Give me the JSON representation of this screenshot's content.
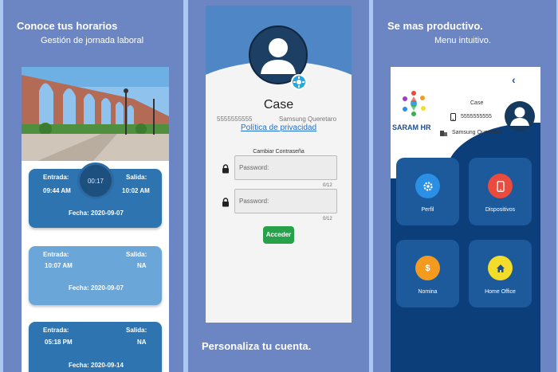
{
  "panel1": {
    "title": "Conoce tus horarios",
    "subtitle": "Gestión de jornada laboral",
    "timer": "00:17",
    "cards": [
      {
        "entrada_label": "Entrada:",
        "entrada": "09:44 AM",
        "salida_label": "Salida:",
        "salida": "10:02 AM",
        "fecha": "Fecha: 2020-09-07"
      },
      {
        "entrada_label": "Entrada:",
        "entrada": "10:07 AM",
        "salida_label": "Salida:",
        "salida": "NA",
        "fecha": "Fecha: 2020-09-07"
      },
      {
        "entrada_label": "Entrada:",
        "entrada": "05:18 PM",
        "salida_label": "Salida:",
        "salida": "NA",
        "fecha": "Fecha: 2020-09-14"
      }
    ]
  },
  "panel2": {
    "name": "Case",
    "phone": "5555555555",
    "location": "Samsung Queretaro",
    "privacy_link": "Política de privacidad",
    "change_password": "Cambiar Contraseña",
    "password_placeholder_1": "Password:",
    "password_placeholder_2": "Password:",
    "counter_1": "0/12",
    "counter_2": "0/12",
    "submit": "Acceder",
    "caption": "Personaliza tu cuenta."
  },
  "panel3": {
    "title": "Se mas productivo.",
    "subtitle": "Menu intuitivo.",
    "back": "‹",
    "brand": "SARAM HR",
    "user_name": "Case",
    "user_phone": "5555555555",
    "user_location": "Samsung Queretaro",
    "tiles": [
      {
        "label": "Perfil",
        "color": "#2b8fe6",
        "icon": "gear-icon"
      },
      {
        "label": "Dispositivos",
        "color": "#ea4b3c",
        "icon": "phone-icon"
      },
      {
        "label": "Nomina",
        "color": "#f39a1f",
        "icon": "dollar-icon"
      },
      {
        "label": "Home Office",
        "color": "#f4dd2a",
        "icon": "home-icon"
      }
    ]
  },
  "colors": {
    "panel_bg": "#6b86c2",
    "card_dark": "#2e74b0",
    "card_light": "#6aa6d8",
    "accent_green": "#27a24a",
    "navy": "#0c3e7a"
  }
}
